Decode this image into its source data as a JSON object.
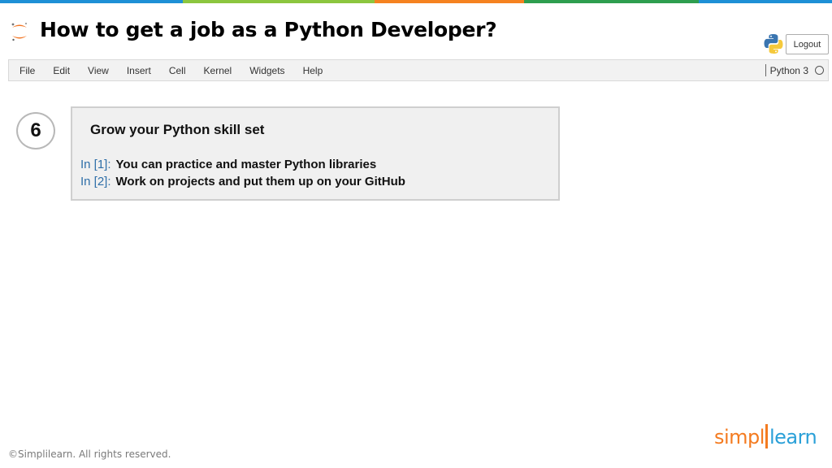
{
  "header": {
    "title": "How to get a job as a Python Developer?",
    "logout_label": "Logout",
    "strip_colors": [
      "#1e90d6",
      "#8cc63f",
      "#f58220",
      "#2e9e4f",
      "#1e90d6"
    ]
  },
  "icons": {
    "app_logo": "jupyter-icon",
    "kernel_logo": "python-icon",
    "kernel_status": "kernel-idle-icon"
  },
  "menubar": {
    "items": [
      "File",
      "Edit",
      "View",
      "Insert",
      "Cell",
      "Kernel",
      "Widgets",
      "Help"
    ],
    "kernel_name": "Python 3"
  },
  "step": {
    "number": "6"
  },
  "cell": {
    "heading": "Grow your Python skill set",
    "lines": [
      {
        "prompt": "In [1]:",
        "text": "You can practice and master Python libraries"
      },
      {
        "prompt": "In [2]:",
        "text": "Work on projects and put them up on your GitHub"
      }
    ]
  },
  "footer": {
    "copyright": "©Simplilearn. All rights reserved.",
    "brand_left": "simpl",
    "brand_right": "learn",
    "brand_colors": {
      "primary": "#f47b20",
      "secondary": "#2aa0d8"
    }
  }
}
